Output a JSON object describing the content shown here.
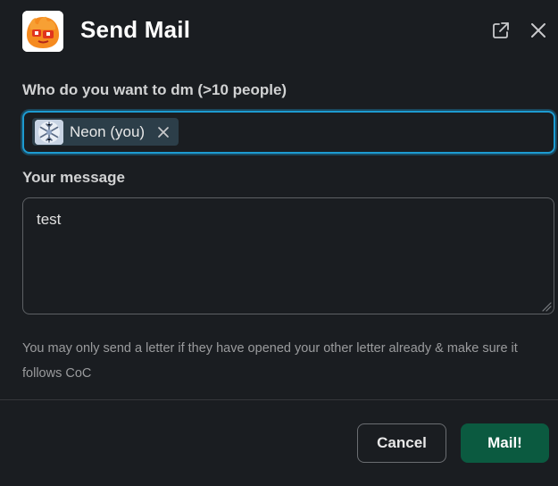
{
  "header": {
    "title": "Send Mail",
    "app_icon": "mail-bot-app-icon",
    "popout_icon": "external-link-icon",
    "close_icon": "close-icon"
  },
  "recipients": {
    "label": "Who do you want to dm (>10 people)",
    "selected": [
      {
        "label": "Neon (you)",
        "avatar": "snowflake-avatar"
      }
    ]
  },
  "message": {
    "label": "Your message",
    "value": "test"
  },
  "hint": "You may only send a letter if they have opened your other letter already & make sure it follows CoC",
  "footer": {
    "cancel_label": "Cancel",
    "submit_label": "Mail!"
  },
  "colors": {
    "background": "#1a1d21",
    "focus_ring": "#1d9bd1",
    "submit_button": "#0b5a40",
    "chip": "#2c3e49"
  }
}
